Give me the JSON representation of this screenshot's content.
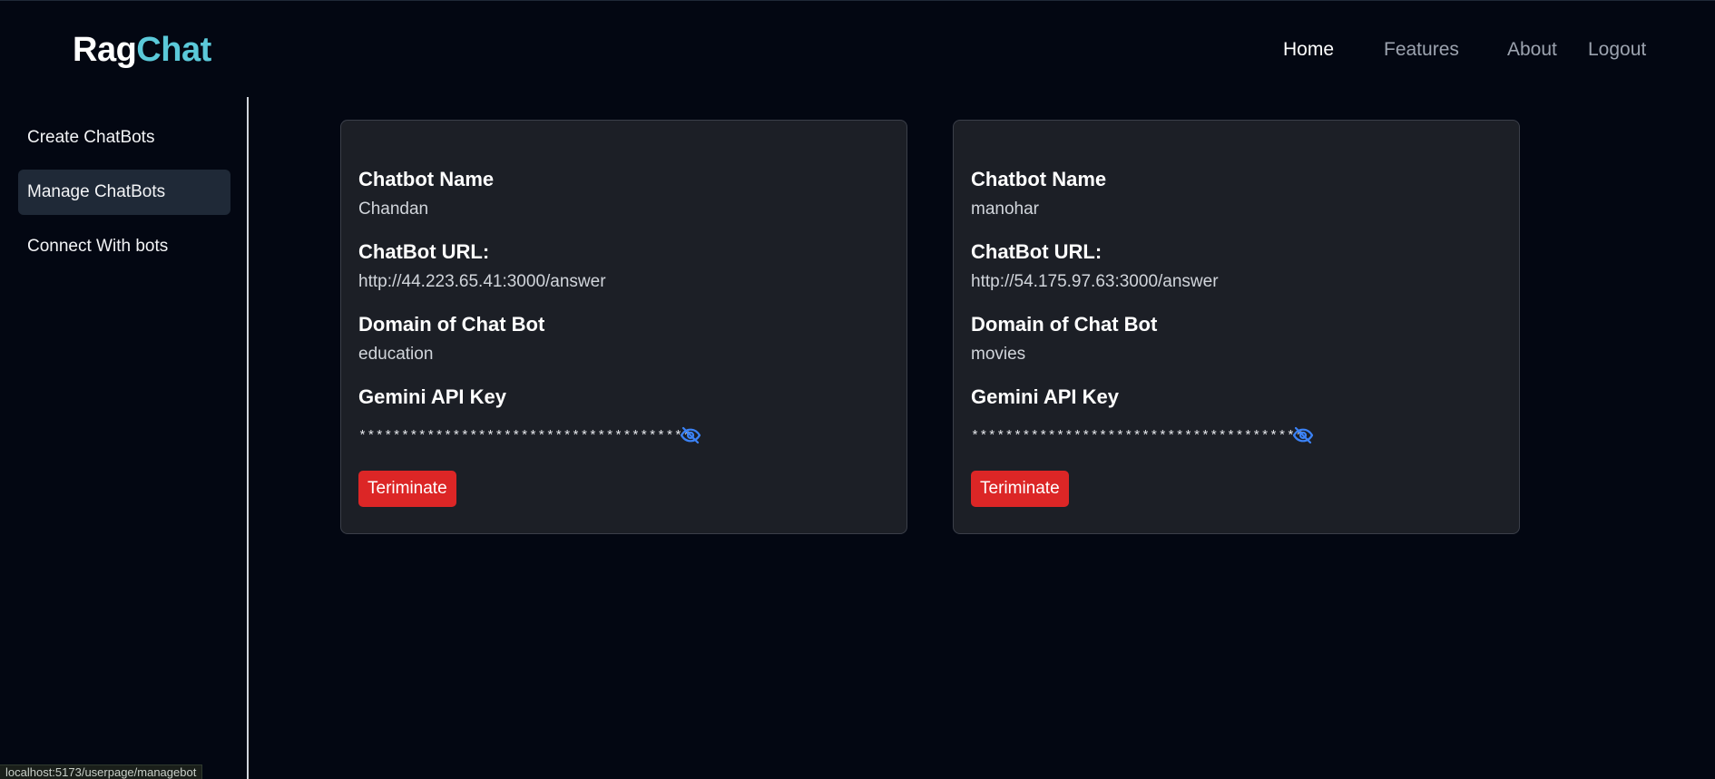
{
  "brand": {
    "part1": "Rag",
    "part2": "Chat",
    "accent_color": "#5bc9d9"
  },
  "nav": {
    "home": "Home",
    "features": "Features",
    "about": "About",
    "logout": "Logout"
  },
  "sidebar": {
    "items": [
      {
        "label": "Create ChatBots",
        "active": false
      },
      {
        "label": "Manage ChatBots",
        "active": true
      },
      {
        "label": "Connect With bots",
        "active": false
      }
    ]
  },
  "labels": {
    "name": "Chatbot Name",
    "url": "ChatBot URL:",
    "domain": "Domain of Chat Bot",
    "api_key": "Gemini API Key",
    "terminate": "Teriminate"
  },
  "bots": [
    {
      "name": "Chandan",
      "url": "http://44.223.65.41:3000/answer",
      "domain": "education",
      "api_key_masked": "***************************************",
      "visibility_icon": "eye-off-icon"
    },
    {
      "name": "manohar",
      "url": "http://54.175.97.63:3000/answer",
      "domain": "movies",
      "api_key_masked": "***************************************",
      "visibility_icon": "eye-off-icon"
    }
  ],
  "colors": {
    "terminate_button": "#dc2626",
    "eye_icon": "#3b82f6"
  },
  "status_bar": {
    "url": "localhost:5173/userpage/managebot"
  }
}
